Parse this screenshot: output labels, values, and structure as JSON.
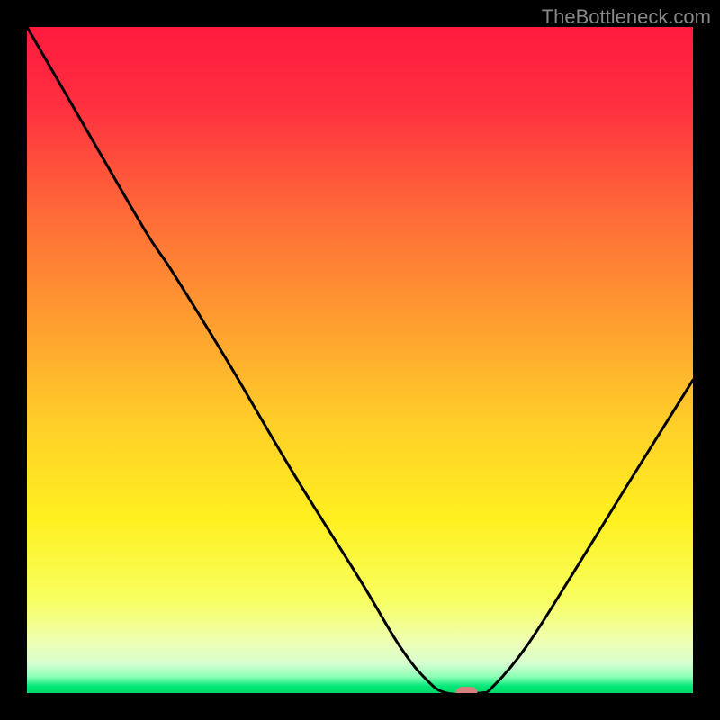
{
  "watermark": "TheBottleneck.com",
  "chart_data": {
    "type": "line",
    "title": "",
    "xlabel": "",
    "ylabel": "",
    "xlim": [
      0,
      100
    ],
    "ylim": [
      0,
      100
    ],
    "background_gradient_stops": [
      {
        "offset": 0.0,
        "color": "#ff1a3e"
      },
      {
        "offset": 0.12,
        "color": "#ff3040"
      },
      {
        "offset": 0.28,
        "color": "#ff6a38"
      },
      {
        "offset": 0.45,
        "color": "#ffa030"
      },
      {
        "offset": 0.6,
        "color": "#ffd028"
      },
      {
        "offset": 0.74,
        "color": "#fff020"
      },
      {
        "offset": 0.86,
        "color": "#f8ff60"
      },
      {
        "offset": 0.92,
        "color": "#f0ffb0"
      },
      {
        "offset": 0.955,
        "color": "#d8ffd0"
      },
      {
        "offset": 0.975,
        "color": "#90ffb8"
      },
      {
        "offset": 0.99,
        "color": "#00e878"
      },
      {
        "offset": 1.0,
        "color": "#00d868"
      }
    ],
    "curve_points": [
      {
        "x": 0,
        "y": 100
      },
      {
        "x": 11,
        "y": 81
      },
      {
        "x": 18,
        "y": 69
      },
      {
        "x": 22,
        "y": 63
      },
      {
        "x": 30,
        "y": 50
      },
      {
        "x": 40,
        "y": 33
      },
      {
        "x": 50,
        "y": 17
      },
      {
        "x": 56,
        "y": 7
      },
      {
        "x": 60,
        "y": 2
      },
      {
        "x": 63,
        "y": 0
      },
      {
        "x": 68,
        "y": 0
      },
      {
        "x": 70,
        "y": 1
      },
      {
        "x": 75,
        "y": 7
      },
      {
        "x": 82,
        "y": 18
      },
      {
        "x": 90,
        "y": 31
      },
      {
        "x": 100,
        "y": 47
      }
    ],
    "marker": {
      "x": 66,
      "y": 0,
      "color": "#d88080"
    }
  }
}
